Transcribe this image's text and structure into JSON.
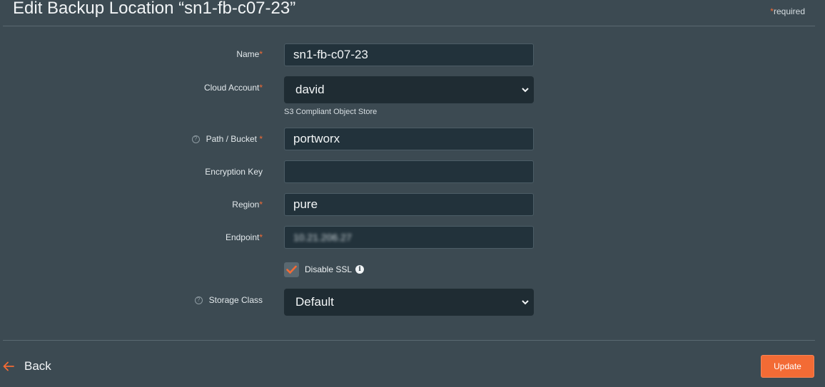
{
  "header": {
    "title": "Edit Backup Location “sn1-fb-c07-23”",
    "required_star": "*",
    "required_text": "required"
  },
  "form": {
    "name": {
      "label": "Name",
      "star": "*",
      "value": "sn1-fb-c07-23"
    },
    "cloud_account": {
      "label": "Cloud Account",
      "star": "*",
      "value": "david",
      "hint": "S3 Compliant Object Store"
    },
    "path_bucket": {
      "label": "Path / Bucket",
      "star": " *",
      "value": "portworx"
    },
    "encryption_key": {
      "label": "Encryption Key",
      "value": ""
    },
    "region": {
      "label": "Region",
      "star": "*",
      "value": "pure"
    },
    "endpoint": {
      "label": "Endpoint",
      "star": "*",
      "value": "10.21.206.27"
    },
    "disable_ssl": {
      "label": "Disable SSL",
      "checked": true
    },
    "storage_class": {
      "label": "Storage Class",
      "value": "Default"
    }
  },
  "footer": {
    "back_label": "Back",
    "update_label": "Update"
  },
  "colors": {
    "accent": "#f36b35",
    "background": "#3c4a52",
    "field_bg": "#22323b"
  }
}
